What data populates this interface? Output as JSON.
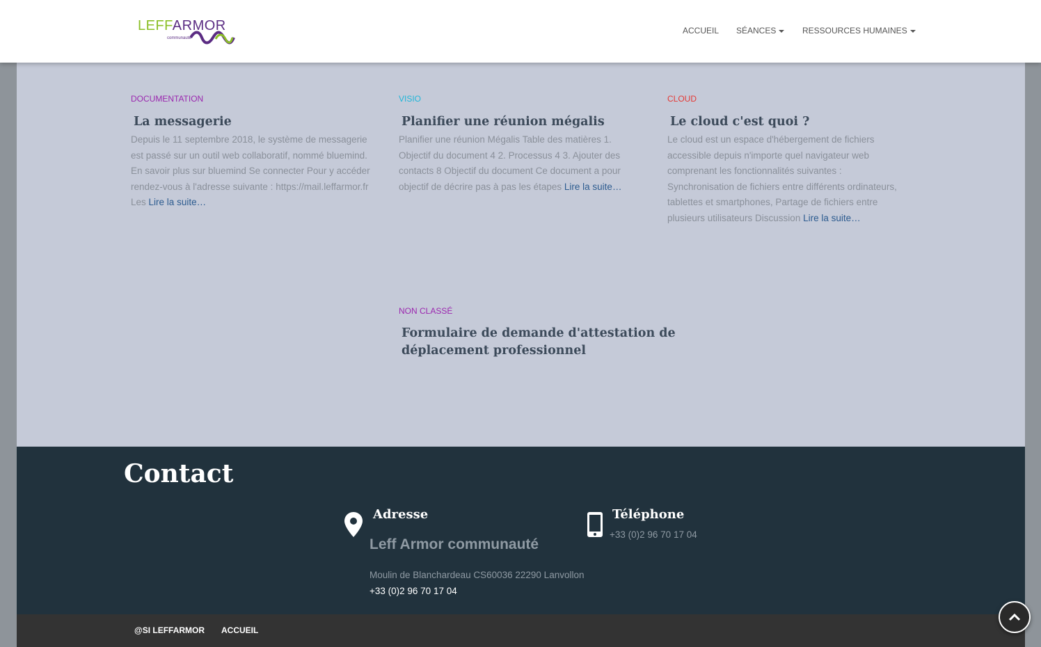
{
  "brand": {
    "logo_leff": "LEFF",
    "logo_armor": "ARMOR",
    "logo_sub": "communauté",
    "colors": {
      "green": "#8bbf26",
      "purple": "#5b2c83"
    }
  },
  "nav": {
    "home": "ACCUEIL",
    "seances": "SÉANCES",
    "rh": "RESSOURCES HUMAINES"
  },
  "posts": [
    {
      "category": "DOCUMENTATION",
      "category_color": "#9b27af",
      "title": "La messagerie",
      "lines": [
        "Depuis le 11 septembre 2018, le système de messagerie",
        "est passé sur un outil web collaboratif, nommé bluemind.",
        "En savoir plus sur bluemind Se connecter Pour y accéder",
        "rendez-vous à l'adresse suivante : https://mail.leffarmor.fr",
        "Les"
      ],
      "more": "Lire la suite…"
    },
    {
      "category": "VISIO",
      "category_color": "#1fb6d9",
      "title": "Planifier une réunion mégalis",
      "lines": [
        "Planifier une réunion Mégalis Table des matières 1.",
        "Objectif du document 4 2. Processus 4 3. Ajouter des",
        "contacts 8 Objectif du document Ce document a pour",
        "objectif de décrire pas à pas les étapes"
      ],
      "more": "Lire la suite…"
    },
    {
      "category": "CLOUD",
      "category_color": "#e53935",
      "title": "Le cloud c'est quoi ?",
      "lines": [
        "Le cloud est un espace d'hébergement de fichiers",
        "accessible depuis n'importe quel navigateur web",
        "comprenant les fonctionnalités suivantes :",
        "Synchronisation de fichiers entre différents ordinateurs,",
        "tablettes et smartphones, Partage de fichiers entre",
        "plusieurs utilisateurs Discussion"
      ],
      "more": "Lire la suite…"
    },
    {
      "category": "NON CLASSÉ",
      "category_color": "#9b27af",
      "title_lines": [
        "Formulaire de demande d'attestation de",
        "déplacement professionnel"
      ]
    }
  ],
  "contact": {
    "title": "Contact",
    "address_title": "Adresse",
    "org": "Leff Armor communauté",
    "address": "Moulin de Blanchardeau CS60036 22290 Lanvollon",
    "address_phone": "+33 (0)2 96 70 17 04",
    "phone_title": "Téléphone",
    "phone": "+33 (0)2 96 70 17 04"
  },
  "footer": {
    "credit": "@SI LEFFARMOR",
    "home": "ACCUEIL"
  },
  "icons": {
    "location": "map-marker-icon",
    "phone": "mobile-phone-icon",
    "top": "chevron-up-icon"
  }
}
